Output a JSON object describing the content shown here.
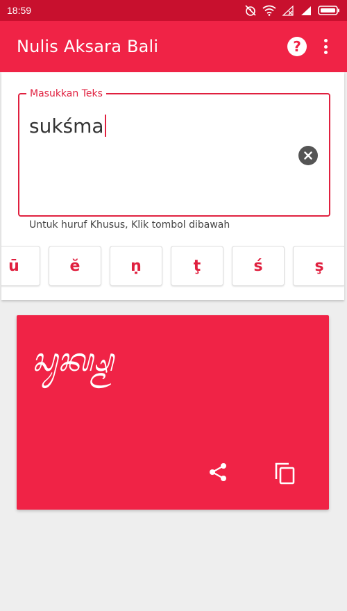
{
  "status_bar": {
    "time": "18:59"
  },
  "app_bar": {
    "title": "Nulis Aksara Bali",
    "help_icon": "?"
  },
  "input": {
    "label": "Masukkan Teks",
    "value": "sukśma",
    "hint": "Untuk huruf Khusus, Klik tombol dibawah"
  },
  "special_keys": [
    "ū",
    "ĕ",
    "ṇ",
    "ţ",
    "ś",
    "ş"
  ],
  "output": {
    "script_text": "ᬲᬸᬓ᭄ᬱ᭄ᬫ"
  },
  "colors": {
    "accent": "#f02346",
    "status_bar": "#c8102e",
    "background": "#eeeeee"
  }
}
